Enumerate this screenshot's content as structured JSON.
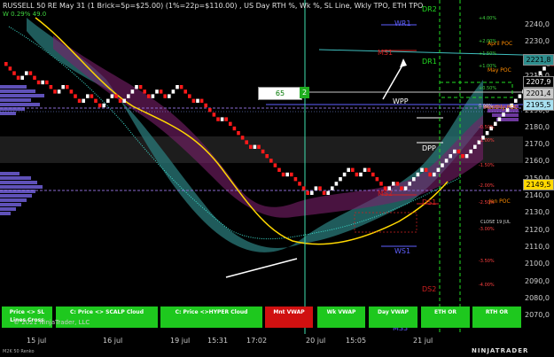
{
  "header": {
    "title": "RUSSELL 50 RE May 31 (1 Brick=5p=$25.00) (1%=22p=$110.00) , US Day RTH %, Wk %, SL Line, Wkly TPO, ETH TPO",
    "sub": "W 0.29% 49.0"
  },
  "price_axis": {
    "ticks": [
      "2240,0",
      "2230,0",
      "2220,0",
      "2210,0",
      "2200,0",
      "2190,0",
      "2180,0",
      "2170,0",
      "2160,0",
      "2150,0",
      "2140,0",
      "2130,0",
      "2120,0",
      "2110,0",
      "2100,0",
      "2090,0",
      "2080,0",
      "2070,0"
    ],
    "price_boxes": [
      {
        "value": "2221,8",
        "color": "#2f8f8f"
      },
      {
        "value": "2207,9",
        "color": "#000000"
      },
      {
        "value": "2201,4",
        "color": "#c8c8c8"
      },
      {
        "value": "2195,5",
        "color": "#a8e0f0"
      },
      {
        "value": "2149,5",
        "color": "#ffd800"
      }
    ]
  },
  "levels": {
    "dr2": "DR2",
    "wr1": "WR1",
    "ms1": "MS1",
    "dr1": "DR1",
    "wpp": "WPP",
    "dpp": "DPP",
    "ms2": "MS2",
    "ds1": "DS1",
    "ws1": "WS1",
    "ds2": "DS2",
    "ms3": "MS3",
    "april_poc": "April POC",
    "may_poc": "May POC",
    "monthly_poc": "Monthly POC",
    "jan_poc": "Jan POC",
    "close_19jul": "CLOSE 19 JUL"
  },
  "pcts": [
    "+4.00%",
    "+2.00%",
    "+1.50%",
    "+1.00%",
    "+0.50%",
    "0.00%",
    "-0.50%",
    "-1.00%",
    "-1.50%",
    "-2.00%",
    "-2.50%",
    "-3.00%",
    "-3.50%",
    "-4.00%"
  ],
  "box": {
    "left": "65",
    "right": "2"
  },
  "buttons": [
    {
      "label": "Price <> SL Lines Cross",
      "color": "#1ec81e"
    },
    {
      "label": "C: Price <> SCALP Cloud",
      "color": "#1ec81e"
    },
    {
      "label": "C: Price <>HYPER Cloud",
      "color": "#1ec81e"
    },
    {
      "label": "Mnt VWAP",
      "color": "#d01010"
    },
    {
      "label": "Wk VWAP",
      "color": "#1ec81e"
    },
    {
      "label": "Day VWAP",
      "color": "#1ec81e"
    },
    {
      "label": "ETH OR",
      "color": "#1ec81e"
    },
    {
      "label": "RTH OR",
      "color": "#1ec81e"
    }
  ],
  "time_axis": [
    "15 jul",
    "16 jul",
    "19 jul",
    "15:31",
    "17:02",
    "20 jul",
    "15:05",
    "21 jul"
  ],
  "footer": {
    "copyright": "© 2021 NinjaTrader, LLC",
    "instrument": "M2K 50 Renko",
    "brand": "NINJATRADER"
  },
  "colors": {
    "up": "#ffffff",
    "down": "#ff1a1a",
    "sma": "#ffd800",
    "vertical": "#3fe0b0",
    "dashed": "#22dd22"
  }
}
